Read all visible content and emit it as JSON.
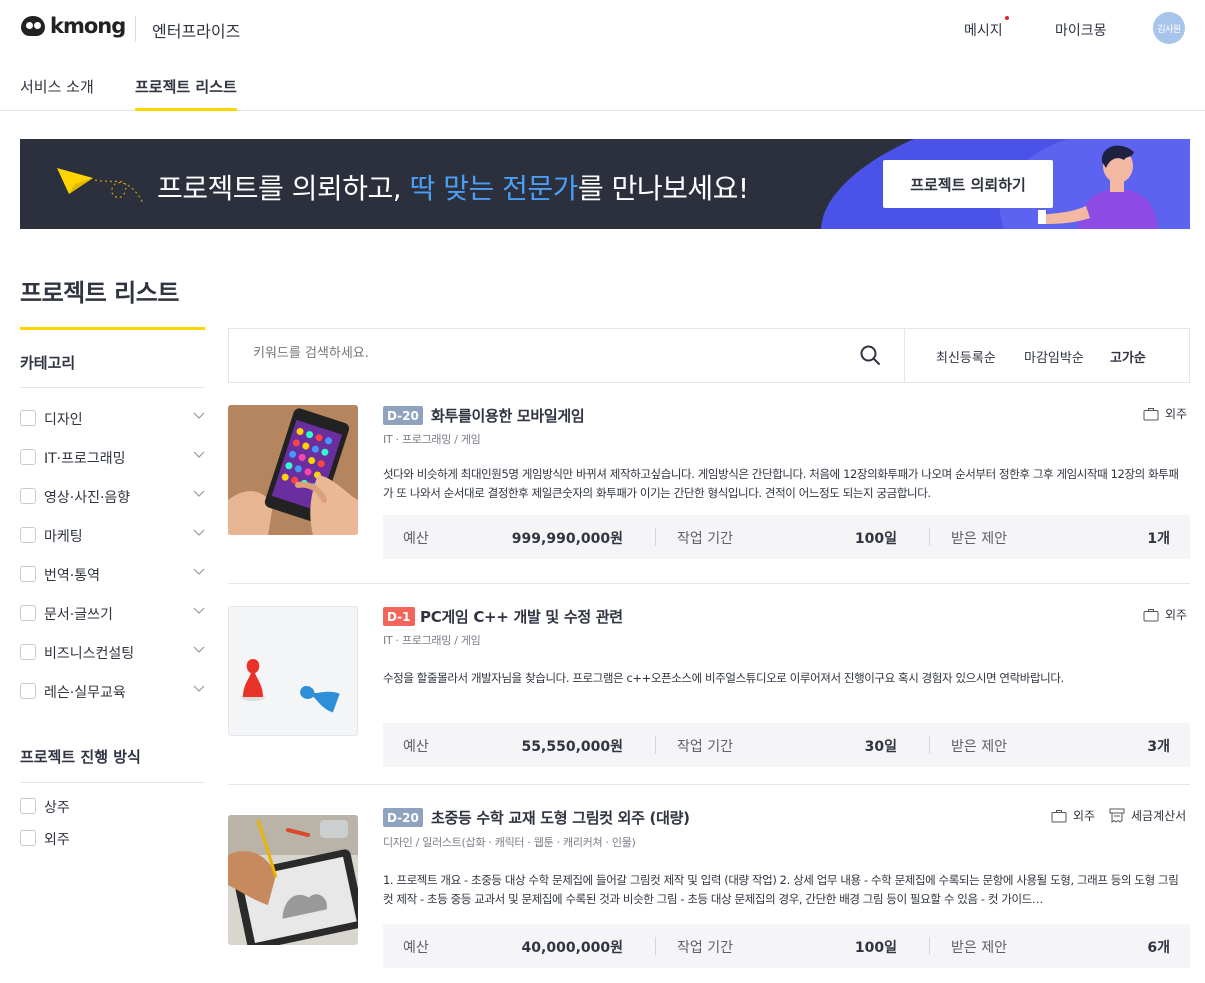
{
  "header": {
    "logo_text": "kmong",
    "enterprise": "엔터프라이즈",
    "messages": "메시지",
    "my_kmong": "마이크몽",
    "avatar_text": "김사원"
  },
  "tabs": [
    {
      "label": "서비스 소개"
    },
    {
      "label": "프로젝트 리스트"
    }
  ],
  "banner": {
    "text_before": "프로젝트를 의뢰하고, ",
    "text_highlight": "딱 맞는 전문가",
    "text_after": "를 만나보세요!",
    "button": "프로젝트 의뢰하기"
  },
  "page_title": "프로젝트 리스트",
  "sidebar": {
    "category_heading": "카테고리",
    "categories": [
      "디자인",
      "IT·프로그래밍",
      "영상·사진·음향",
      "마케팅",
      "번역·통역",
      "문서·글쓰기",
      "비즈니스컨설팅",
      "레슨·실무교육"
    ],
    "method_heading": "프로젝트 진행 방식",
    "methods": [
      "상주",
      "외주"
    ]
  },
  "search": {
    "placeholder": "키워드를 검색하세요.",
    "sort_options": [
      "최신등록순",
      "마감임박순",
      "고가순"
    ],
    "active_sort": "고가순"
  },
  "colors": {
    "accent_yellow": "#ffd400",
    "dday_gray": "#8fa3bf",
    "dday_red": "#f2665a",
    "banner_bg": "#2c2f3c",
    "banner_highlight": "#4a9ff5"
  },
  "stat_labels": {
    "budget": "예산",
    "period": "작업 기간",
    "proposals": "받은 제안"
  },
  "projects": [
    {
      "dday": "D-20",
      "title": "화투를이용한 모바일게임",
      "category": "IT · 프로그래밍 / 게임",
      "description": "섯다와 비슷하게 최대인원5명 게임방식만 바뀌셔 제작하고싶습니다. 게임방식은 간단합니다. 처음에 12장의화투패가 나오며 순서부터 정한후 그후 게임시작때 12장의 화투패가 또 나와서 순서대로 결정한후 제일큰숫자의 화투패가 이기는 간단한 형식입니다. 견적이 어느정도 되는지 궁금합니다.",
      "tags": [
        "외주"
      ],
      "budget": "999,990,000원",
      "period": "100일",
      "proposals": "1개"
    },
    {
      "dday": "D-1",
      "title": "PC게임 C++ 개발 및 수정 관련",
      "category": "IT · 프로그래밍 / 게임",
      "description": "수정을 할줄몰라서 개발자님을 찾습니다. 프로그램은 c++오픈소스에 비주얼스튜디오로 이루어져서 진행이구요 혹시 경험자 있으시면 연락바랍니다.",
      "tags": [
        "외주"
      ],
      "budget": "55,550,000원",
      "period": "30일",
      "proposals": "3개"
    },
    {
      "dday": "D-20",
      "title": "초중등 수학 교재 도형 그림컷 외주 (대량)",
      "category": "디자인 / 일러스트(삽화 · 캐릭터 · 웹툰 · 캐리커쳐 · 인물)",
      "description": "1. 프로젝트 개요 - 초중등 대상 수학 문제집에 들어갈 그림컷 제작 및 입력 (대량 작업) 2. 상세 업무 내용 - 수학 문제집에 수록되는 문항에 사용될 도형, 그래프 등의 도형 그림컷 제작 - 초등 중등 교과서 및 문제집에 수록된 것과 비슷한 그림 - 초등 대상 문제집의 경우, 간단한 배경 그림 등이 필요할 수 있음 - 컷 가이드…",
      "tags": [
        "외주",
        "세금계산서"
      ],
      "budget": "40,000,000원",
      "period": "100일",
      "proposals": "6개"
    }
  ]
}
